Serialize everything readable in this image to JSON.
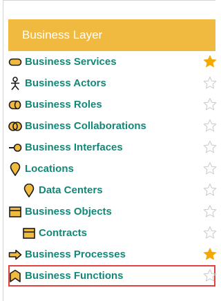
{
  "panel": {
    "title": "Business Layer",
    "header_color": "#f0b93f",
    "text_color": "#128878",
    "selection_color": "#e0423f"
  },
  "items": [
    {
      "label": "Business Services",
      "icon": "service-pill-icon",
      "favorite": true,
      "indent": false,
      "selected": false
    },
    {
      "label": "Business Actors",
      "icon": "actor-stick-figure-icon",
      "favorite": false,
      "indent": false,
      "selected": false
    },
    {
      "label": "Business Roles",
      "icon": "role-capsule-icon",
      "favorite": false,
      "indent": false,
      "selected": false
    },
    {
      "label": "Business Collaborations",
      "icon": "collaboration-circles-icon",
      "favorite": false,
      "indent": false,
      "selected": false
    },
    {
      "label": "Business Interfaces",
      "icon": "interface-lollipop-icon",
      "favorite": false,
      "indent": false,
      "selected": false
    },
    {
      "label": "Locations",
      "icon": "location-pin-icon",
      "favorite": false,
      "indent": false,
      "selected": false
    },
    {
      "label": "Data Centers",
      "icon": "location-pin-icon",
      "favorite": false,
      "indent": true,
      "selected": false
    },
    {
      "label": "Business Objects",
      "icon": "object-box-icon",
      "favorite": false,
      "indent": false,
      "selected": false
    },
    {
      "label": "Contracts",
      "icon": "object-box-icon",
      "favorite": false,
      "indent": true,
      "selected": false
    },
    {
      "label": "Business Processes",
      "icon": "process-arrow-icon",
      "favorite": true,
      "indent": false,
      "selected": false
    },
    {
      "label": "Business Functions",
      "icon": "function-chevron-icon",
      "favorite": false,
      "indent": false,
      "selected": true
    }
  ]
}
